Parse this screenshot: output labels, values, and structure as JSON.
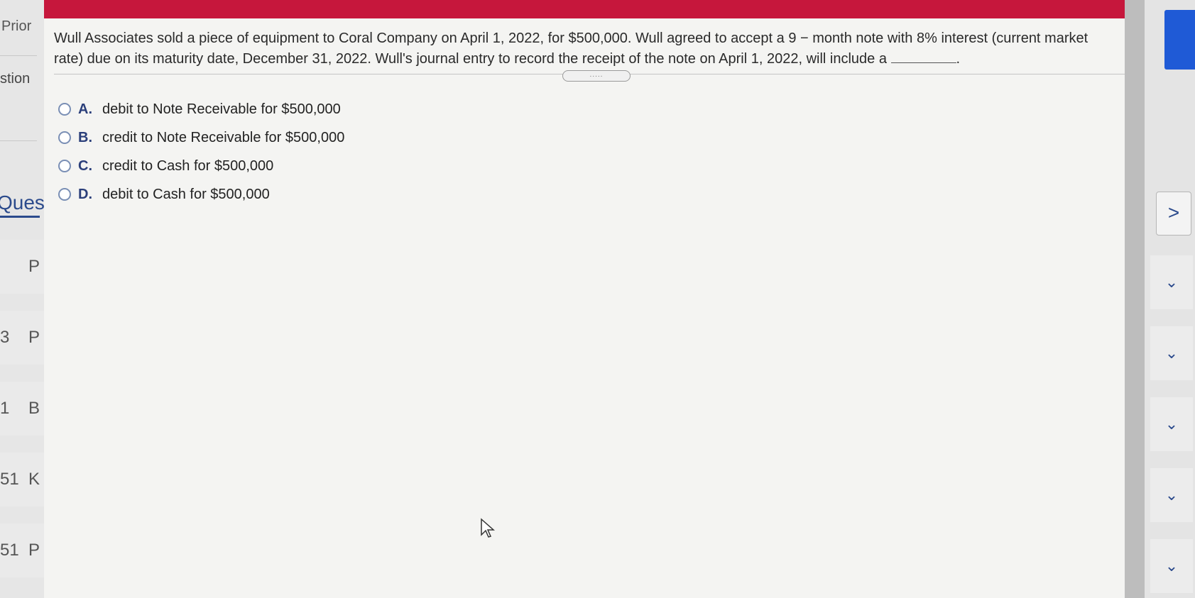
{
  "sidebar": {
    "prior_label": "Prior",
    "section_label": "stion",
    "questions_label": "Ques",
    "items": [
      {
        "num": "",
        "letter": "P"
      },
      {
        "num": "3",
        "letter": "P"
      },
      {
        "num": "1",
        "letter": "B"
      },
      {
        "num": "51",
        "letter": "K"
      },
      {
        "num": "51",
        "letter": "P"
      }
    ]
  },
  "question": {
    "text": "Wull Associates sold a piece of equipment to Coral Company on April 1, 2022, for $500,000. Wull agreed to accept a 9 − month note with 8% interest (current market rate) due on its maturity date, December 31, 2022. Wull's journal entry to record the receipt of the note on April 1, 2022, will include a",
    "trailing": "."
  },
  "grip_label": ".....",
  "options": [
    {
      "letter": "A.",
      "text": "debit to Note Receivable for $500,000"
    },
    {
      "letter": "B.",
      "text": "credit to Note Receivable for $500,000"
    },
    {
      "letter": "C.",
      "text": "credit to Cash for $500,000"
    },
    {
      "letter": "D.",
      "text": "debit to Cash for $500,000"
    }
  ],
  "right": {
    "next_icon": ">",
    "chevron": "⌄"
  },
  "colors": {
    "topbar": "#c6173c",
    "accent_blue": "#1f5ad6",
    "text_blue": "#2b4a8c"
  }
}
